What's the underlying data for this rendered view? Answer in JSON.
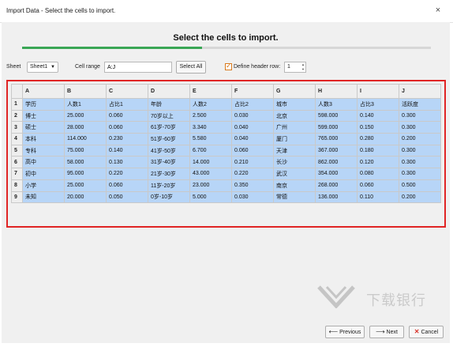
{
  "window": {
    "title": "Import Data - Select the cells to import.",
    "close_glyph": "×"
  },
  "wizard": {
    "heading": "Select the cells to import.",
    "progress_fraction": 0.44
  },
  "controls": {
    "sheet_label": "Sheet",
    "sheet_value": "Sheet1",
    "cell_range_label": "Cell range",
    "cell_range_value": "A:J",
    "select_all_label": "Select All",
    "define_header_label": "Define header row:",
    "define_header_checked": true,
    "header_row_value": "1"
  },
  "grid": {
    "column_headers": [
      "A",
      "B",
      "C",
      "D",
      "E",
      "F",
      "G",
      "H",
      "I",
      "J"
    ],
    "rows": [
      {
        "num": "1",
        "cells": [
          "学历",
          "人数1",
          "占比1",
          "年龄",
          "人数2",
          "占比2",
          "城市",
          "人数3",
          "占比3",
          "活跃度"
        ]
      },
      {
        "num": "2",
        "cells": [
          "博士",
          "25.000",
          "0.060",
          "70岁以上",
          "2.500",
          "0.030",
          "北京",
          "598.000",
          "0.140",
          "0.300"
        ]
      },
      {
        "num": "3",
        "cells": [
          "硕士",
          "28.000",
          "0.060",
          "61岁-70岁",
          "3.340",
          "0.040",
          "广州",
          "599.000",
          "0.150",
          "0.300"
        ]
      },
      {
        "num": "4",
        "cells": [
          "本科",
          "114.000",
          "0.230",
          "51岁-60岁",
          "5.580",
          "0.040",
          "厦门",
          "765.000",
          "0.280",
          "0.200"
        ]
      },
      {
        "num": "5",
        "cells": [
          "专科",
          "75.000",
          "0.140",
          "41岁-50岁",
          "6.700",
          "0.060",
          "天津",
          "367.000",
          "0.180",
          "0.300"
        ]
      },
      {
        "num": "6",
        "cells": [
          "高中",
          "58.000",
          "0.130",
          "31岁-40岁",
          "14.000",
          "0.210",
          "长沙",
          "862.000",
          "0.120",
          "0.300"
        ]
      },
      {
        "num": "7",
        "cells": [
          "初中",
          "95.000",
          "0.220",
          "21岁-30岁",
          "43.000",
          "0.220",
          "武汉",
          "354.000",
          "0.080",
          "0.300"
        ]
      },
      {
        "num": "8",
        "cells": [
          "小学",
          "25.000",
          "0.060",
          "11岁-20岁",
          "23.000",
          "0.350",
          "南京",
          "268.000",
          "0.060",
          "0.500"
        ]
      },
      {
        "num": "9",
        "cells": [
          "未知",
          "20.000",
          "0.050",
          "0岁-10岁",
          "5.000",
          "0.030",
          "常德",
          "136.000",
          "0.110",
          "0.200"
        ]
      }
    ]
  },
  "footer": {
    "previous_label": "Previous",
    "next_label": "Next",
    "cancel_label": "Cancel"
  },
  "watermark": {
    "text": "下载银行"
  },
  "icons": {
    "close": "close-icon",
    "previous": "arrow-left-icon",
    "next": "arrow-right-icon",
    "cancel": "cancel-x-icon",
    "sheet_dropdown": "chevron-down-icon",
    "spinner": "spinner-arrows-icon"
  },
  "colors": {
    "progress": "#3aa655",
    "selection_fill": "#b7d5f7",
    "outline": "#e02424",
    "checkbox": "#d97a1c",
    "cancel_icon": "#d9332a"
  }
}
